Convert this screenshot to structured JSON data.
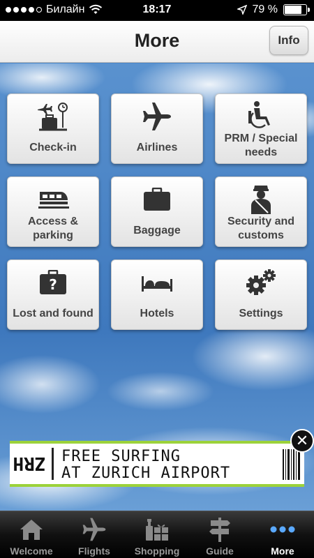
{
  "status_bar": {
    "carrier": "Билайн",
    "time": "18:17",
    "battery_percent": "79 %",
    "battery_level": 0.79
  },
  "nav": {
    "title": "More",
    "info_label": "Info"
  },
  "tiles": [
    {
      "label": "Check-in",
      "icon": "check-in-icon"
    },
    {
      "label": "Airlines",
      "icon": "airplane-icon"
    },
    {
      "label": "PRM / Special needs",
      "icon": "wheelchair-icon"
    },
    {
      "label": "Access & parking",
      "icon": "train-icon"
    },
    {
      "label": "Baggage",
      "icon": "suitcase-icon"
    },
    {
      "label": "Security and customs",
      "icon": "security-officer-icon"
    },
    {
      "label": "Lost and found",
      "icon": "lost-luggage-icon"
    },
    {
      "label": "Hotels",
      "icon": "bed-icon"
    },
    {
      "label": "Settings",
      "icon": "gears-icon"
    }
  ],
  "ad": {
    "line1": "FREE SURFING",
    "line2": "AT ZURICH AIRPORT",
    "logo_text": "ZRH",
    "accent_color": "#9cd23a"
  },
  "tab_bar": {
    "tabs": [
      {
        "label": "Welcome",
        "icon": "home-icon"
      },
      {
        "label": "Flights",
        "icon": "airplane-icon"
      },
      {
        "label": "Shopping",
        "icon": "shopping-icon"
      },
      {
        "label": "Guide",
        "icon": "signpost-icon"
      },
      {
        "label": "More",
        "icon": "more-dots-icon",
        "active": true
      }
    ],
    "active_color": "#5aa9ff"
  }
}
